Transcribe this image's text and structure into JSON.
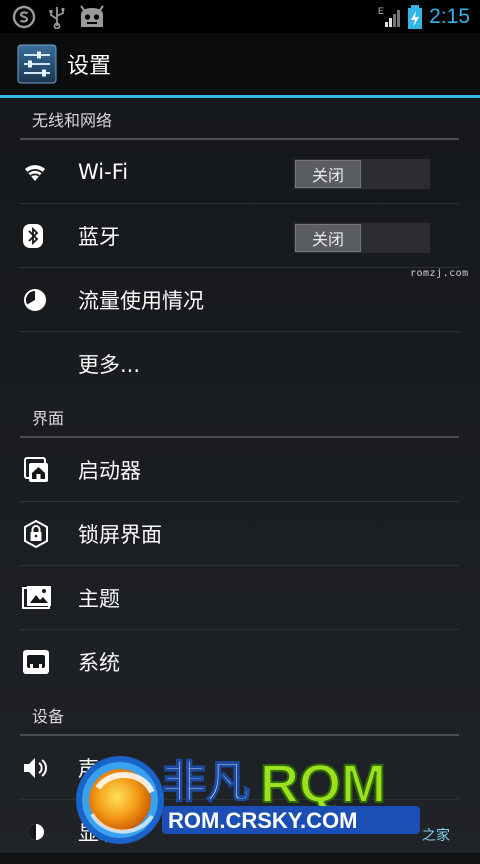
{
  "status_bar": {
    "network_type": "E",
    "time": "2:15",
    "icons": [
      "s-circle-icon",
      "usb-icon",
      "cyanogen-android-icon",
      "signal-icon",
      "battery-charging-icon"
    ]
  },
  "action_bar": {
    "title": "设置",
    "icon": "settings-sliders-icon"
  },
  "sections": [
    {
      "header": "无线和网络",
      "items": [
        {
          "label": "Wi-Fi",
          "icon": "wifi-icon",
          "toggle": "关闭"
        },
        {
          "label": "蓝牙",
          "icon": "bluetooth-icon",
          "toggle": "关闭"
        },
        {
          "label": "流量使用情况",
          "icon": "data-usage-icon"
        },
        {
          "label": "更多..."
        }
      ]
    },
    {
      "header": "界面",
      "items": [
        {
          "label": "启动器",
          "icon": "launcher-icon"
        },
        {
          "label": "锁屏界面",
          "icon": "lock-screen-icon"
        },
        {
          "label": "主题",
          "icon": "theme-icon"
        },
        {
          "label": "系统",
          "icon": "system-icon"
        }
      ]
    },
    {
      "header": "设备",
      "items": [
        {
          "label": "声音",
          "icon": "sound-icon"
        },
        {
          "label": "显示",
          "icon": "display-icon"
        }
      ]
    }
  ],
  "watermark": {
    "small": "romzj.com",
    "brand_cn": "非凡",
    "brand_en": "RQM",
    "url": "ROM.CRSKY.COM",
    "corner": "之家"
  },
  "colors": {
    "accent": "#33b5e5",
    "background": "#15181b",
    "brand_green": "#9ee01e"
  }
}
